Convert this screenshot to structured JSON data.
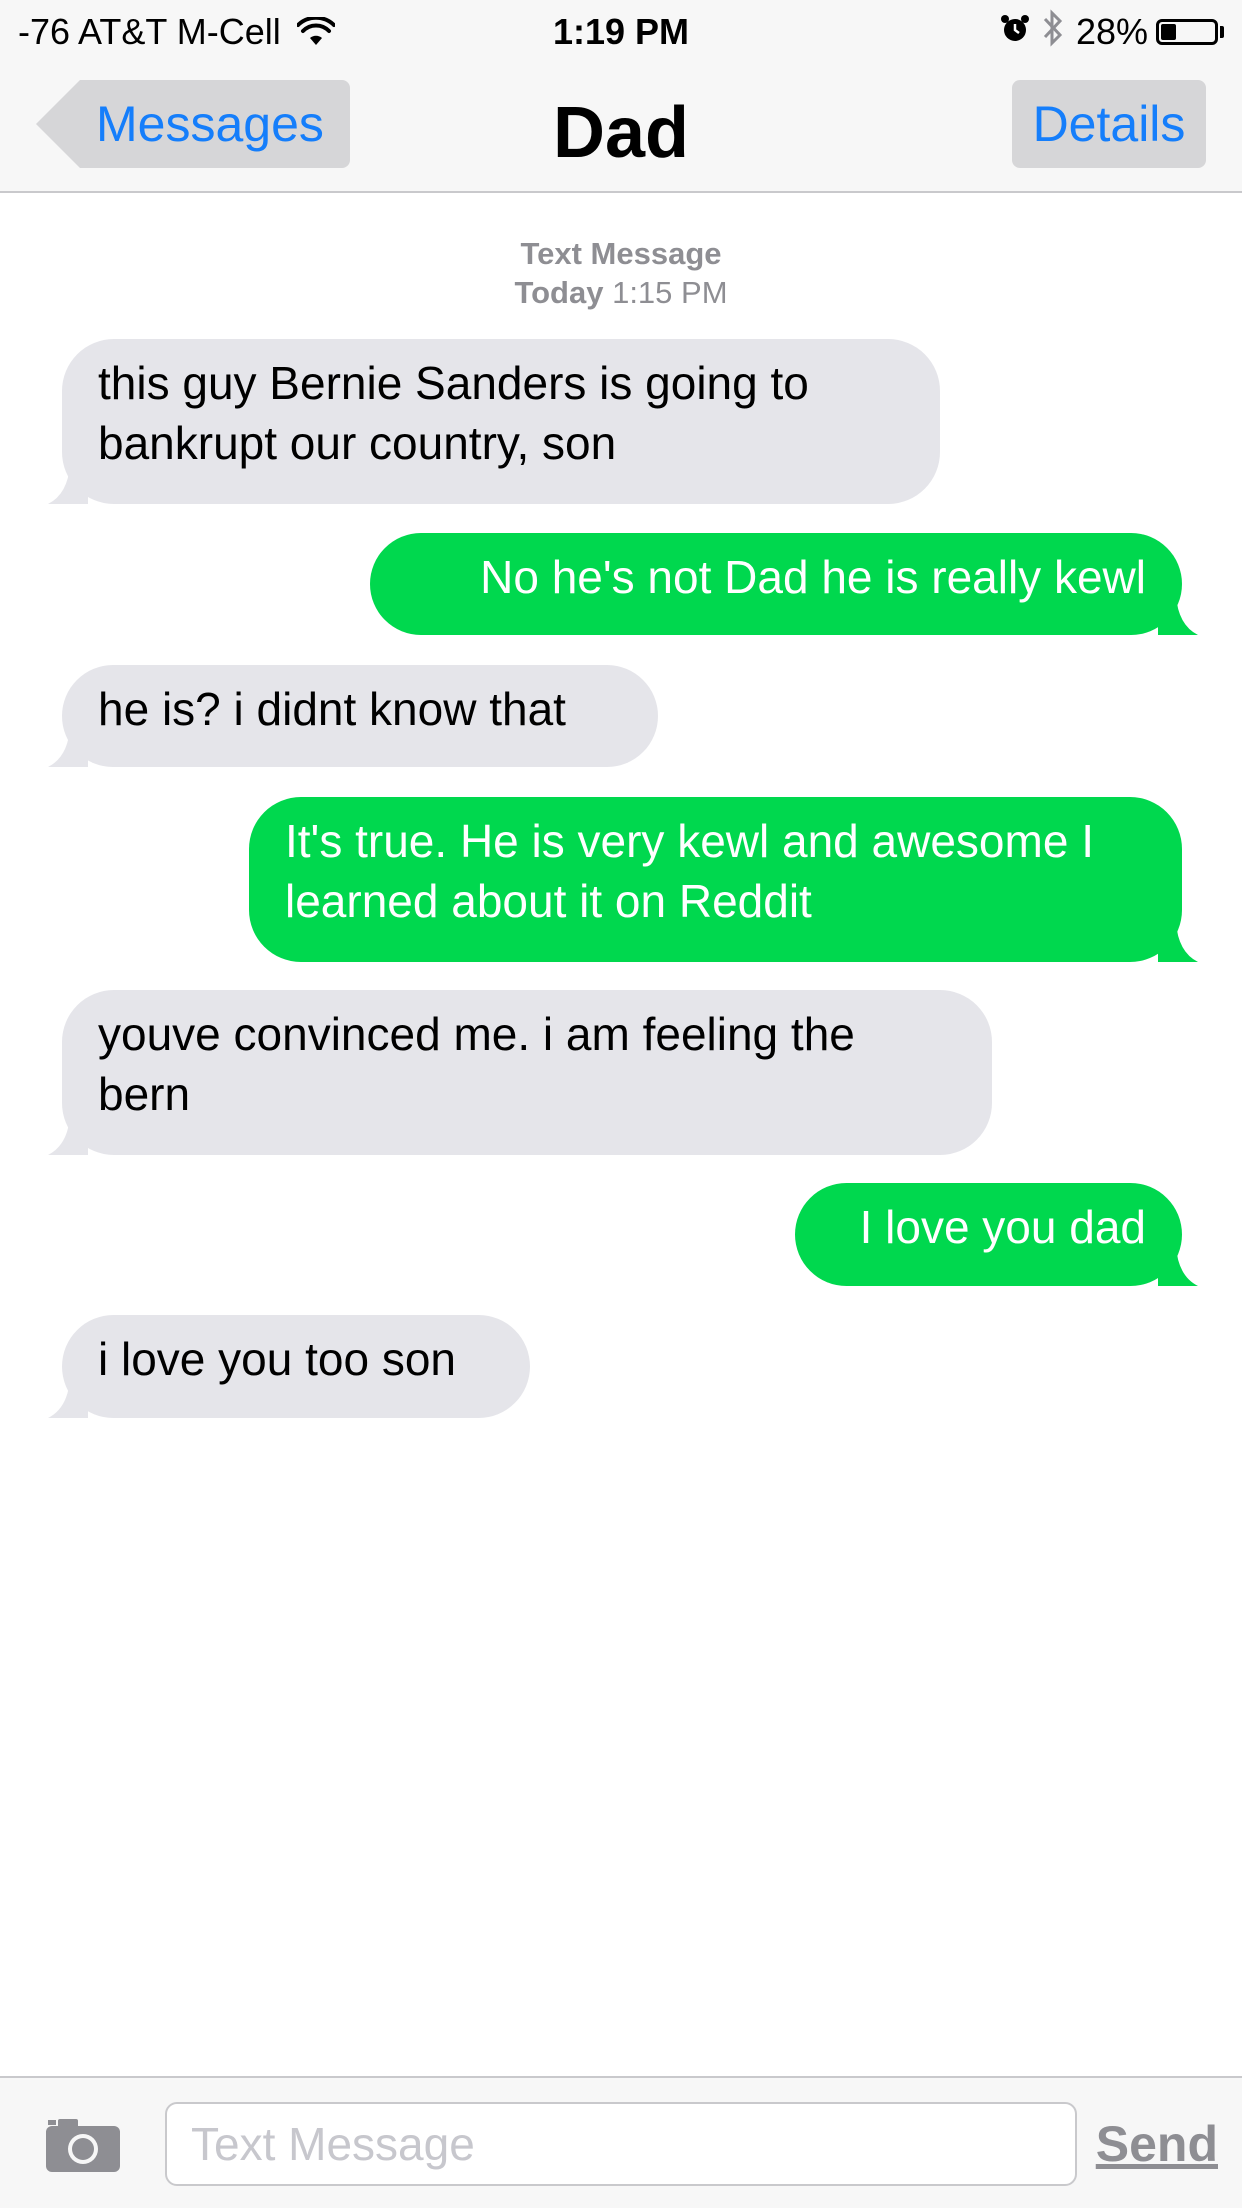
{
  "status_bar": {
    "carrier": "-76 AT&T M-Cell",
    "time": "1:19 PM",
    "battery": "28%",
    "battery_level": 0.28
  },
  "nav": {
    "back_label": "Messages",
    "title": "Dad",
    "details_label": "Details"
  },
  "conversation": {
    "meta_kind": "Text Message",
    "meta_day": "Today",
    "meta_time": "1:15 PM",
    "messages": [
      {
        "direction": "in",
        "text": "this guy Bernie Sanders is going to bankrupt our country, son"
      },
      {
        "direction": "out",
        "text": "No he's not Dad he is really kewl"
      },
      {
        "direction": "in",
        "text": "he is? i didnt know that"
      },
      {
        "direction": "out",
        "text": "It's true. He is very kewl and awesome I learned about it on Reddit"
      },
      {
        "direction": "in",
        "text": "youve convinced me. i am feeling the bern"
      },
      {
        "direction": "out",
        "text": "I love you dad"
      },
      {
        "direction": "in",
        "text": "i love you too son"
      }
    ]
  },
  "input_bar": {
    "placeholder": "Text Message",
    "send_label": "Send"
  },
  "colors": {
    "incoming_bubble": "#e5e5ea",
    "outgoing_bubble": "#00d84e",
    "link_blue": "#157efb",
    "meta_gray": "#8e8e93"
  }
}
